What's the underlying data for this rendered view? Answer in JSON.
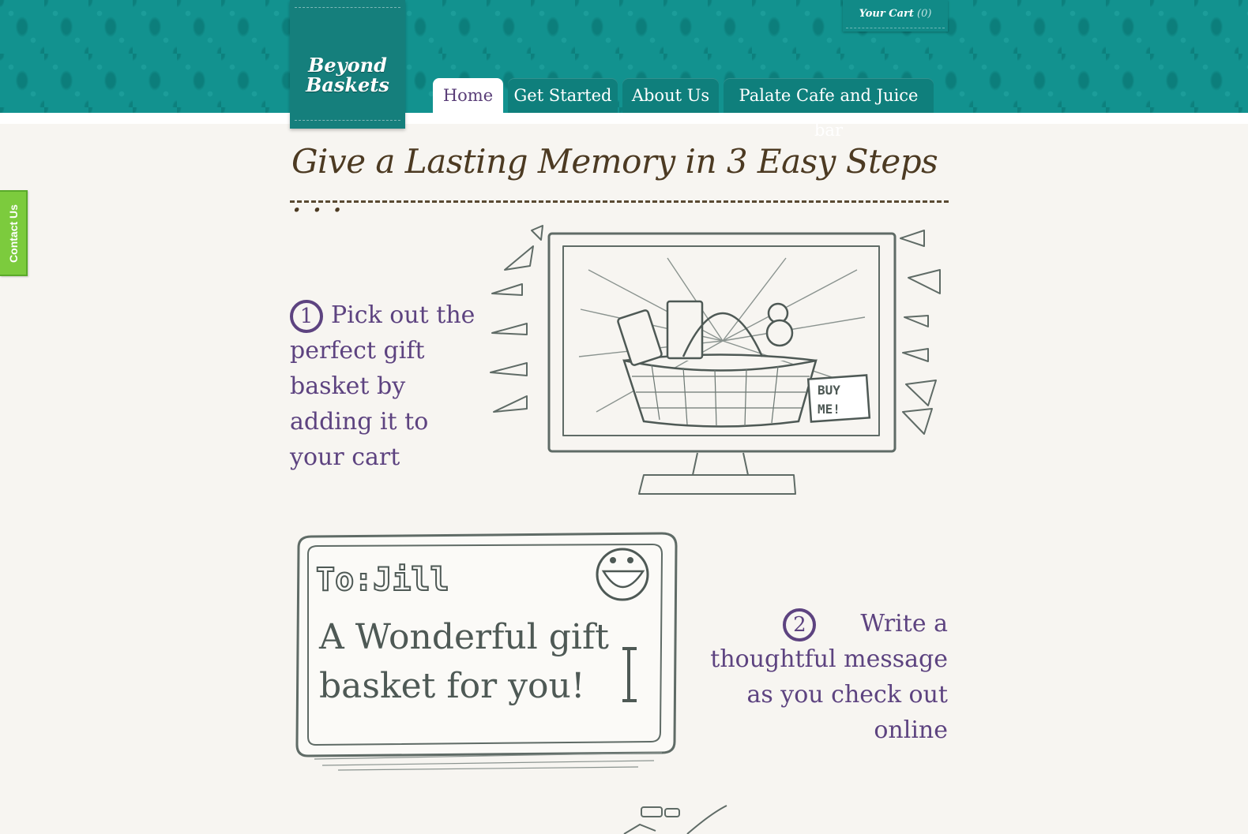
{
  "logo": {
    "line1": "Beyond",
    "line2": "Baskets"
  },
  "cart": {
    "label": "Your Cart",
    "count": "(0)"
  },
  "nav": {
    "tabs": [
      {
        "label": "Home"
      },
      {
        "label": "Get Started"
      },
      {
        "label": "About Us"
      },
      {
        "label": "Palate Cafe and Juice bar"
      }
    ]
  },
  "contact": {
    "label": "Contact Us"
  },
  "main": {
    "heading": "Give a Lasting Memory in 3 Easy Steps . . .",
    "steps": [
      {
        "number": "1",
        "text": "Pick out the perfect gift basket by adding it to your cart"
      },
      {
        "number": "2",
        "text": "Write a thoughtful message as you check out online"
      }
    ],
    "card_to": "To:Jill",
    "card_message": "A Wonderful gift basket for you!",
    "buy_me": "BUY ME!"
  },
  "colors": {
    "header_teal": "#12928f",
    "logo_teal": "#157f7c",
    "step_purple": "#5d4380",
    "heading_brown": "#4c3a22",
    "contact_green": "#7ccb3d",
    "page_bg": "#f7f5f1"
  }
}
